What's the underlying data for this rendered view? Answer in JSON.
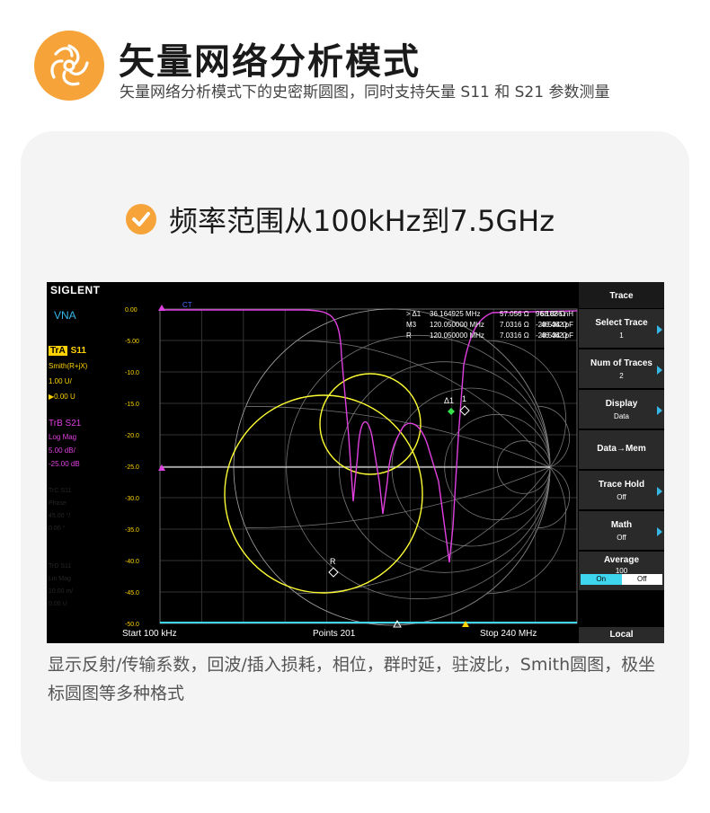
{
  "header": {
    "logo_icon": "orange-swirl-aperture-icon",
    "title": "矢量网络分析模式",
    "subtitle": "矢量网络分析模式下的史密斯圆图，同时支持矢量 S11 和 S21 参数测量"
  },
  "feature": {
    "icon": "check-circle-icon",
    "text": "频率范围从100kHz到7.5GHz"
  },
  "instrument": {
    "brand": "SIGLENT",
    "mode": "VNA",
    "traceA": {
      "tag": "TrA",
      "param": "S11",
      "format": "Smith(R+jX)",
      "scale": "1.00 U/",
      "ref": "▶0.00 U"
    },
    "traceB": {
      "tag": "TrB",
      "param": "S21",
      "format": "Log Mag",
      "scale": "5.00 dB/",
      "ref": "-25.00 dB"
    },
    "ghost_labels": [
      "TrC S11",
      "Phase",
      "45.00 °/",
      "0.00 °",
      "TrD S11",
      "Lin Mag",
      "10.00 m/",
      "0.00 U"
    ],
    "y_ticks": [
      "0.00",
      "-5.00",
      "-10.0",
      "-15.0",
      "-20.0",
      "-25.0",
      "-30.0",
      "-35.0",
      "-40.0",
      "-45.0",
      "-50.0"
    ],
    "marker_table": [
      {
        "name": "> Δ1",
        "freq": "36.164925 MHz",
        "r": "57.056 Ω",
        "x": "96.102 Ω",
        "c": "68.886 nH"
      },
      {
        "name": "M3",
        "freq": "120.050000 MHz",
        "r": "7.0316 Ω",
        "x": "-28.534 Ω",
        "c": "46.462 pF"
      },
      {
        "name": "R",
        "freq": "120.050000 MHz",
        "r": "7.0316 Ω",
        "x": "-28.534 Ω",
        "c": "46.462 pF"
      }
    ],
    "ct_label": "CT",
    "markers": {
      "delta": "Δ1",
      "one": "1",
      "ref": "R"
    },
    "bottom": {
      "start": "Start 100 kHz",
      "points": "Points  201",
      "stop": "Stop 240 MHz"
    },
    "menu": [
      {
        "label": "Trace",
        "value": ""
      },
      {
        "label": "Select Trace",
        "value": "1"
      },
      {
        "label": "Num of Traces",
        "value": "2"
      },
      {
        "label": "Display",
        "value": "Data"
      },
      {
        "label": "Data→Mem",
        "value": ""
      },
      {
        "label": "Trace Hold",
        "value": "Off"
      },
      {
        "label": "Math",
        "value": "Off"
      },
      {
        "label": "Average",
        "value": "100"
      },
      {
        "label": "Local",
        "value": ""
      }
    ],
    "average_toggle": {
      "on": "On",
      "off": "Off"
    },
    "colors": {
      "s11": "#ffff33",
      "s21": "#e040e0",
      "accent": "#35b8e6",
      "orange": "#f6a33a"
    }
  },
  "caption": "显示反射/传输系数，回波/插入损耗，相位，群时延，驻波比，Smith圆图，极坐标圆图等多种格式"
}
